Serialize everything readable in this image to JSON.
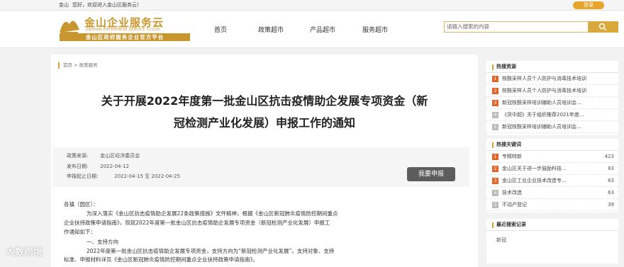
{
  "topbar": {
    "location": "金山",
    "welcome": "您好，欢迎进入金山区服务云！",
    "login": "登录"
  },
  "header": {
    "logo_cn": "金山企业服务云",
    "logo_en": "JINSHAN ENTERPRISE SERVICE CLOUD",
    "logo_tagline": "金山区政府服务企业官方平台",
    "nav": [
      "首页",
      "政策超市",
      "产品超市",
      "服务超市"
    ],
    "search_placeholder": "请输入搜索的内容"
  },
  "breadcrumb": "首页 > 政策服务",
  "title_line1": "关于开展2022年度第一批金山区抗击疫情助企发展专项资金（新",
  "title_line2": "冠检测产业化发展）申报工作的通知",
  "meta": {
    "source_label": "政策来源:",
    "source_value": "金山区经济委员会",
    "date_label": "发布日期:",
    "date_value": "2022-04-12",
    "period_label": "申报起止日期:",
    "period_value": "2022-04-15 至 2022-04-25",
    "apply_button": "我要申报"
  },
  "body": [
    "各镇（园区）：",
    "为深入落实《金山区抗击疫情助企发展22条政策措施》文件精神，根据《金山区新冠肺炎疫情防控期间重点",
    "企业扶持政策申请指南》，现就2022年度第一批金山区抗击疫情助企发展专项资金（新冠检测产业化发展）申报工",
    "作通知如下：",
    "一、支持方向",
    "2022年度第一批金山区抗击疫情助企发展专项资金，支持方向为“新冠检测产业化发展”。支持对象、支持",
    "标准、申报材料详见《金山区新冠肺炎疫情防控期间重点企业扶持政策申请指南》。"
  ],
  "sidebar": {
    "hot_title": "热搜资源",
    "hot_items": [
      {
        "num": "1",
        "text": "核酸采样人员个人防护与消毒技术培训"
      },
      {
        "num": "2",
        "text": "核酸采样人员个人防护与消毒技术培训"
      },
      {
        "num": "3",
        "text": "新冠核酸采样培训辅助人员培训会..."
      },
      {
        "num": "4",
        "text": "《货中超》关于组织推荐2021年度..."
      },
      {
        "num": "5",
        "text": "新冠核酸采样培训辅助人员培训会..."
      }
    ],
    "kw_title": "热搜关键词",
    "kw_items": [
      {
        "num": "1",
        "text": "专精特新",
        "count": "423"
      },
      {
        "num": "2",
        "text": "金山区关于进一步鼓励科技...",
        "count": "83"
      },
      {
        "num": "3",
        "text": "金山区工业企业技术改造专...",
        "count": "63"
      },
      {
        "num": "4",
        "text": "技术改造",
        "count": "63"
      },
      {
        "num": "5",
        "text": "不动产登记",
        "count": "39"
      }
    ],
    "recent_title": "最近搜索记录",
    "recent_item": "新冠"
  },
  "watermark": "大数跨境"
}
